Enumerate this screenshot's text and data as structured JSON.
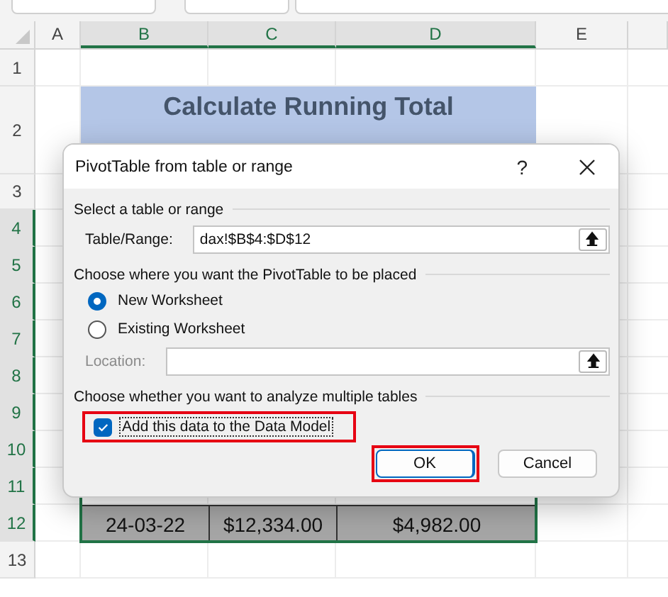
{
  "columns": [
    {
      "label": "A",
      "selected": false
    },
    {
      "label": "B",
      "selected": true
    },
    {
      "label": "C",
      "selected": true
    },
    {
      "label": "D",
      "selected": true
    },
    {
      "label": "E",
      "selected": false
    }
  ],
  "rows": [
    {
      "label": "1",
      "selected": false
    },
    {
      "label": "2",
      "selected": false
    },
    {
      "label": "3",
      "selected": false
    },
    {
      "label": "4",
      "selected": true
    },
    {
      "label": "5",
      "selected": true
    },
    {
      "label": "6",
      "selected": true
    },
    {
      "label": "7",
      "selected": true
    },
    {
      "label": "8",
      "selected": true
    },
    {
      "label": "9",
      "selected": true
    },
    {
      "label": "10",
      "selected": true
    },
    {
      "label": "11",
      "selected": true
    },
    {
      "label": "12",
      "selected": true
    },
    {
      "label": "13",
      "selected": false
    }
  ],
  "title_cell": {
    "lines": [
      "Calculate Running Total"
    ]
  },
  "data_row": {
    "cells": [
      "24-03-22",
      "$12,334.00",
      "$4,982.00"
    ]
  },
  "dialog": {
    "title": "PivotTable from table or range",
    "help": "?",
    "source_section": {
      "heading": "Select a table or range",
      "label": "Table/Range:",
      "value": "dax!$B$4:$D$12"
    },
    "placement_section": {
      "heading": "Choose where you want the PivotTable to be placed",
      "options": [
        {
          "label": "New Worksheet",
          "selected": true
        },
        {
          "label": "Existing Worksheet",
          "selected": false
        }
      ],
      "location": {
        "label": "Location:",
        "disabled": true
      }
    },
    "model_section": {
      "heading": "Choose whether you want to analyze multiple tables",
      "checkbox": {
        "label": "Add this data to the Data Model",
        "checked": true,
        "highlighted": true
      }
    },
    "buttons": [
      {
        "label": "OK",
        "default": true,
        "highlighted": true
      },
      {
        "label": "Cancel",
        "default": false,
        "highlighted": false
      }
    ]
  }
}
